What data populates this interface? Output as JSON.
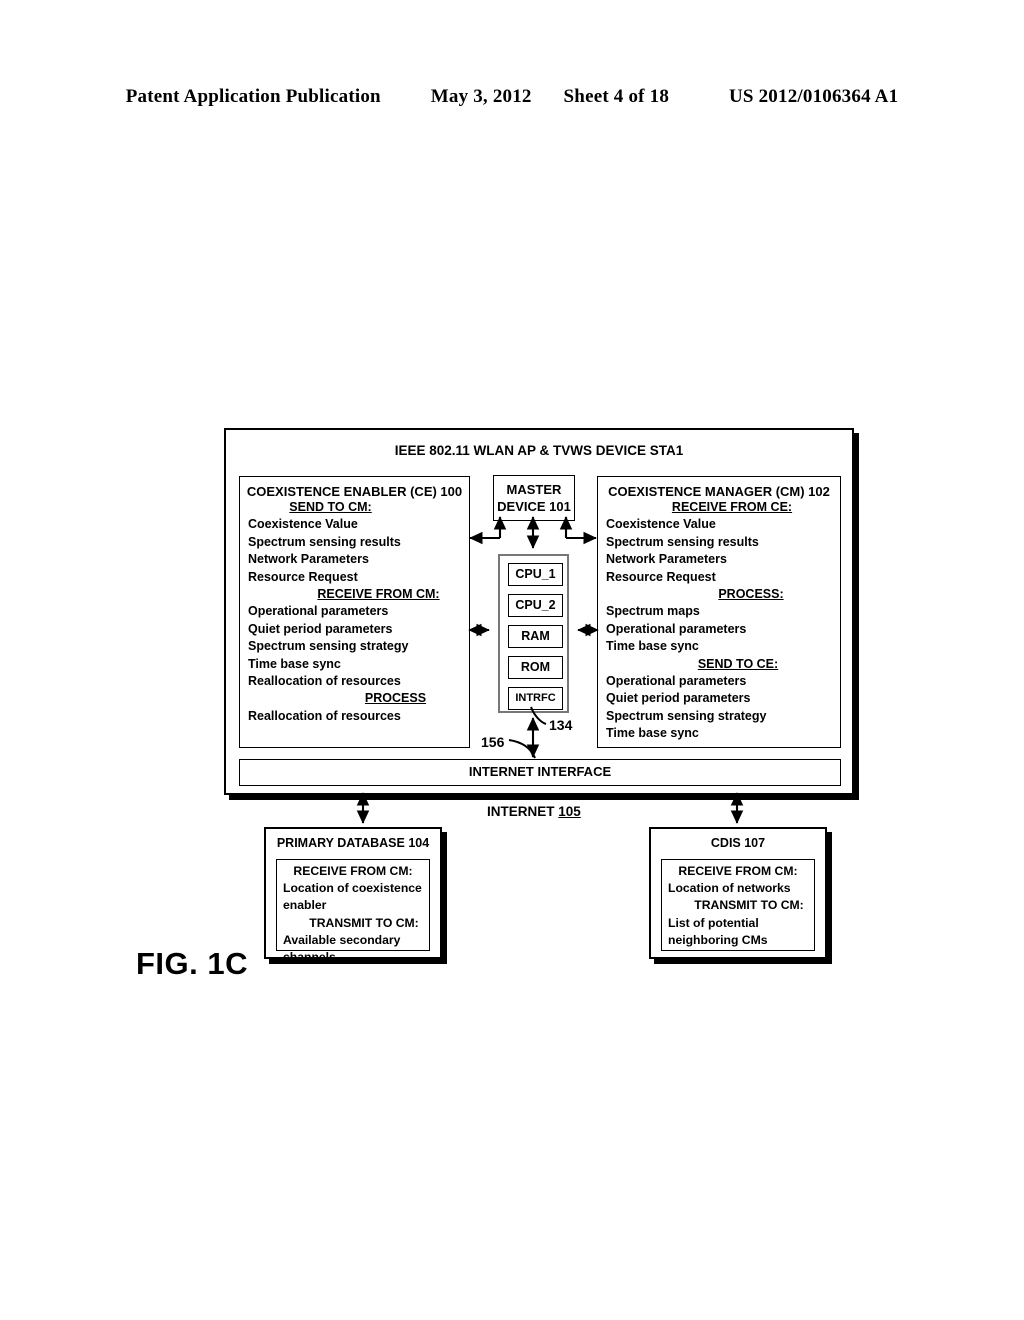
{
  "header": {
    "publication": "Patent Application Publication",
    "date": "May 3, 2012",
    "sheet": "Sheet 4 of 18",
    "patent_number": "US 2012/0106364 A1"
  },
  "figure": {
    "label": "FIG. 1C"
  },
  "sta_frame": {
    "title": "IEEE 802.11 WLAN AP & TVWS DEVICE STA1"
  },
  "coexistence_enabler": {
    "title": "COEXISTENCE ENABLER (CE) 100",
    "sections": [
      {
        "heading": "SEND TO CM:",
        "items": [
          "Coexistence Value",
          "Spectrum sensing results",
          "Network Parameters",
          "Resource Request"
        ]
      },
      {
        "heading": "RECEIVE FROM CM:",
        "items": [
          "Operational parameters",
          "Quiet period parameters",
          "Spectrum sensing strategy",
          "Time base sync",
          "Reallocation of resources"
        ]
      },
      {
        "heading": "PROCESS",
        "items": [
          "Reallocation of resources"
        ]
      }
    ]
  },
  "coexistence_manager": {
    "title": "COEXISTENCE MANAGER (CM) 102",
    "sections": [
      {
        "heading": "RECEIVE FROM CE:",
        "items": [
          "Coexistence Value",
          "Spectrum sensing results",
          "Network Parameters",
          "Resource Request"
        ]
      },
      {
        "heading": "PROCESS:",
        "items": [
          "Spectrum maps",
          "Operational parameters",
          "Time base sync"
        ]
      },
      {
        "heading": "SEND TO CE:",
        "items": [
          "Operational parameters",
          "Quiet period parameters",
          "Spectrum sensing strategy",
          "Time base sync"
        ]
      }
    ]
  },
  "master_device": {
    "title_line1": "MASTER",
    "title_line2": "DEVICE 101",
    "components": [
      "CPU_1",
      "CPU_2",
      "RAM",
      "ROM",
      "INTRFC"
    ],
    "ref_numeral": "134"
  },
  "internet_interface": {
    "label": "INTERNET INTERFACE",
    "ref_numeral": "156"
  },
  "internet": {
    "label": "INTERNET ",
    "ref": "105"
  },
  "primary_database": {
    "title": "PRIMARY DATABASE 104",
    "sections": [
      {
        "heading": "RECEIVE FROM CM:",
        "items": [
          "Location of coexistence",
          "enabler"
        ]
      },
      {
        "heading": "TRANSMIT TO CM:",
        "items": [
          "Available secondary",
          "channels"
        ]
      }
    ]
  },
  "cdis": {
    "title": "CDIS 107",
    "sections": [
      {
        "heading": "RECEIVE FROM CM:",
        "items": [
          "Location of networks"
        ]
      },
      {
        "heading": "TRANSMIT TO CM:",
        "items": [
          "List of potential",
          "neighboring CMs"
        ]
      }
    ]
  },
  "colors": {
    "ink": "#000000",
    "paper": "#ffffff"
  }
}
